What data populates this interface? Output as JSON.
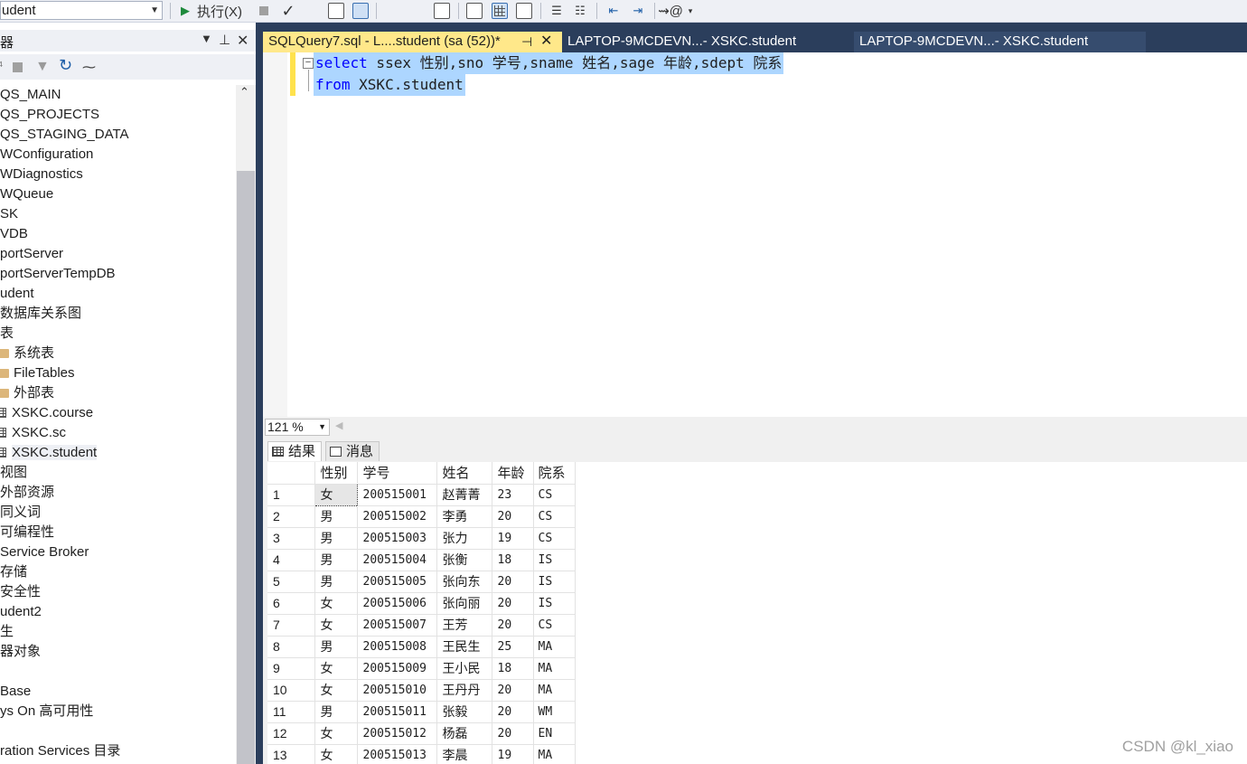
{
  "toolbar": {
    "database": "udent",
    "execute_label": "执行(X)"
  },
  "explorer": {
    "title": "器",
    "items": [
      {
        "label": "QS_MAIN",
        "icon": ""
      },
      {
        "label": "QS_PROJECTS",
        "icon": ""
      },
      {
        "label": "QS_STAGING_DATA",
        "icon": ""
      },
      {
        "label": "WConfiguration",
        "icon": ""
      },
      {
        "label": "WDiagnostics",
        "icon": ""
      },
      {
        "label": "WQueue",
        "icon": ""
      },
      {
        "label": "SK",
        "icon": ""
      },
      {
        "label": "VDB",
        "icon": ""
      },
      {
        "label": "portServer",
        "icon": ""
      },
      {
        "label": "portServerTempDB",
        "icon": ""
      },
      {
        "label": "udent",
        "icon": ""
      },
      {
        "label": "数据库关系图",
        "icon": ""
      },
      {
        "label": "表",
        "icon": ""
      },
      {
        "label": "系统表",
        "icon": "folder"
      },
      {
        "label": "FileTables",
        "icon": "folder"
      },
      {
        "label": "外部表",
        "icon": "folder"
      },
      {
        "label": "XSKC.course",
        "icon": "table"
      },
      {
        "label": "XSKC.sc",
        "icon": "table"
      },
      {
        "label": "XSKC.student",
        "icon": "table"
      },
      {
        "label": "视图",
        "icon": ""
      },
      {
        "label": "外部资源",
        "icon": ""
      },
      {
        "label": "同义词",
        "icon": ""
      },
      {
        "label": "可编程性",
        "icon": ""
      },
      {
        "label": "Service Broker",
        "icon": ""
      },
      {
        "label": "存储",
        "icon": ""
      },
      {
        "label": "安全性",
        "icon": ""
      },
      {
        "label": "udent2",
        "icon": ""
      },
      {
        "label": "生",
        "icon": ""
      },
      {
        "label": "器对象",
        "icon": ""
      },
      {
        "label": "",
        "icon": ""
      },
      {
        "label": "Base",
        "icon": ""
      },
      {
        "label": "ys On 高可用性",
        "icon": ""
      },
      {
        "label": "",
        "icon": ""
      },
      {
        "label": "ration Services 目录",
        "icon": ""
      }
    ]
  },
  "tabs": [
    {
      "label": "SQLQuery7.sql - L....student (sa (52))*",
      "active": true
    },
    {
      "label": "LAPTOP-9MCDEVN...- XSKC.student",
      "active": false
    },
    {
      "label": "LAPTOP-9MCDEVN...- XSKC.student",
      "active": false
    }
  ],
  "editor": {
    "line1_kw": "select",
    "line1_rest": " ssex 性别,sno 学号,sname 姓名,sage 年龄,sdept 院系",
    "line2_kw": "from",
    "line2_rest": " XSKC.student",
    "zoom": "121 %"
  },
  "results": {
    "tab_results": "结果",
    "tab_messages": "消息",
    "columns": [
      "性别",
      "学号",
      "姓名",
      "年龄",
      "院系"
    ],
    "rows": [
      [
        "1",
        "女",
        "200515001",
        "赵菁菁",
        "23",
        "CS"
      ],
      [
        "2",
        "男",
        "200515002",
        "李勇",
        "20",
        "CS"
      ],
      [
        "3",
        "男",
        "200515003",
        "张力",
        "19",
        "CS"
      ],
      [
        "4",
        "男",
        "200515004",
        "张衡",
        "18",
        "IS"
      ],
      [
        "5",
        "男",
        "200515005",
        "张向东",
        "20",
        "IS"
      ],
      [
        "6",
        "女",
        "200515006",
        "张向丽",
        "20",
        "IS"
      ],
      [
        "7",
        "女",
        "200515007",
        "王芳",
        "20",
        "CS"
      ],
      [
        "8",
        "男",
        "200515008",
        "王民生",
        "25",
        "MA"
      ],
      [
        "9",
        "女",
        "200515009",
        "王小民",
        "18",
        "MA"
      ],
      [
        "10",
        "女",
        "200515010",
        "王丹丹",
        "20",
        "MA"
      ],
      [
        "11",
        "男",
        "200515011",
        "张毅",
        "20",
        "WM"
      ],
      [
        "12",
        "女",
        "200515012",
        "杨磊",
        "20",
        "EN"
      ],
      [
        "13",
        "女",
        "200515013",
        "李晨",
        "19",
        "MA"
      ]
    ]
  },
  "watermark": "CSDN @kl_xiao"
}
